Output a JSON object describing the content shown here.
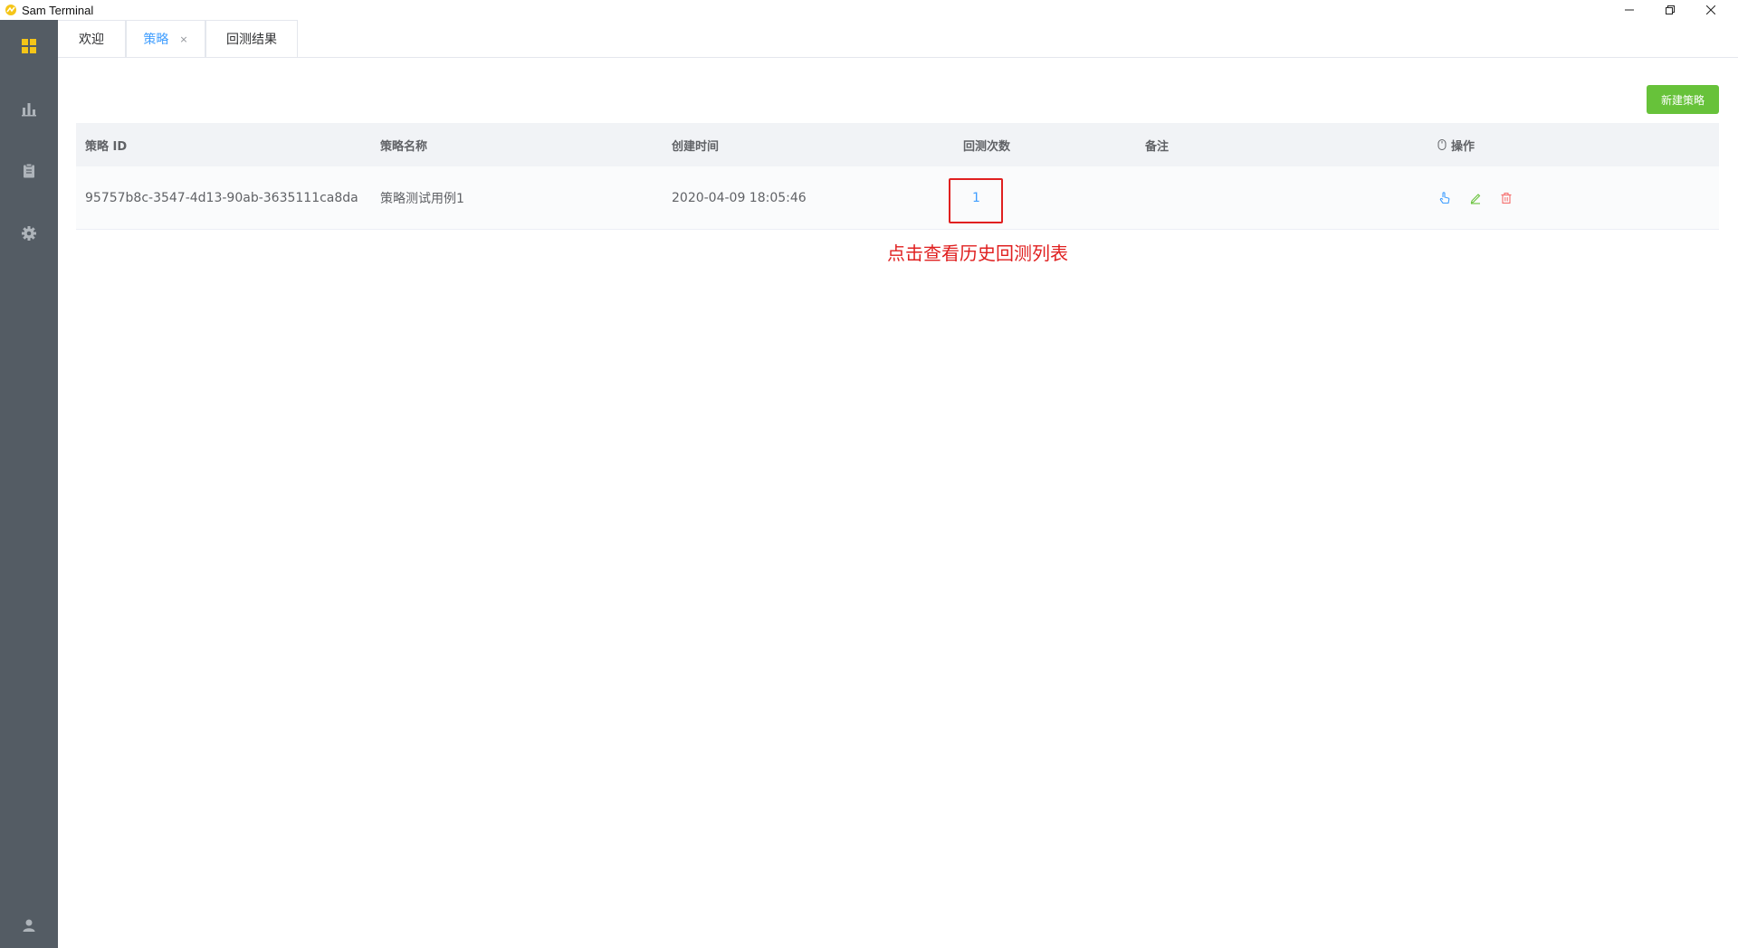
{
  "window": {
    "title": "Sam Terminal"
  },
  "tabs": [
    {
      "label": "欢迎"
    },
    {
      "label": "策略",
      "close": "×"
    },
    {
      "label": "回测结果"
    }
  ],
  "toolbar": {
    "new_label": "新建策略"
  },
  "table": {
    "headers": [
      "策略 ID",
      "策略名称",
      "创建时间",
      "回测次数",
      "备注",
      "操作"
    ],
    "rows": [
      {
        "id": "95757b8c-3547-4d13-90ab-3635111ca8da",
        "name": "策略测试用例1",
        "created": "2020-04-09 18:05:46",
        "count": "1",
        "remark": ""
      }
    ]
  },
  "annotation": {
    "text": "点击查看历史回测列表"
  },
  "colors": {
    "sidebar": "#545c64",
    "accent": "#409eff",
    "success": "#67c23a",
    "danger": "#f56c6c",
    "annotation": "#e02020"
  }
}
